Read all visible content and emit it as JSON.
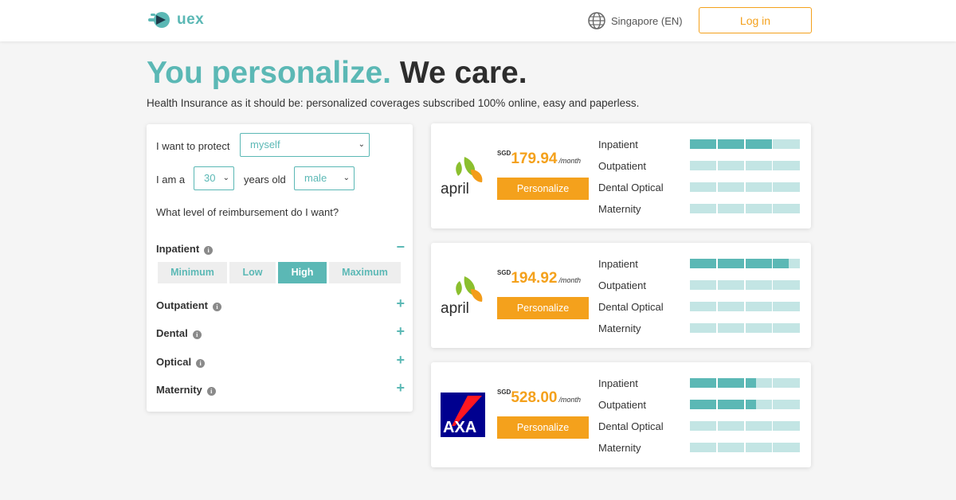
{
  "header": {
    "brand": "uex",
    "region": "Singapore (EN)",
    "login_label": "Log in"
  },
  "hero": {
    "title_part1": "You personalize.",
    "title_part2": "We care.",
    "subtitle": "Health Insurance as it should be: personalized coverages subscribed 100% online, easy and paperless."
  },
  "filters": {
    "protect_label": "I want to protect",
    "protect_value": "myself",
    "age_prefix": "I am a",
    "age_value": "30",
    "age_suffix": "years old",
    "gender_value": "male",
    "question": "What level of reimbursement do I want?",
    "levels": [
      "Minimum",
      "Low",
      "High",
      "Maximum"
    ],
    "selected_level": "High",
    "coverages": [
      {
        "label": "Inpatient",
        "expanded": true,
        "toggle": "−"
      },
      {
        "label": "Outpatient",
        "expanded": false,
        "toggle": "+"
      },
      {
        "label": "Dental",
        "expanded": false,
        "toggle": "+"
      },
      {
        "label": "Optical",
        "expanded": false,
        "toggle": "+"
      },
      {
        "label": "Maternity",
        "expanded": false,
        "toggle": "+"
      }
    ]
  },
  "plans": [
    {
      "insurer": "april",
      "currency": "SGD",
      "price": "179.94",
      "period": "/month",
      "button_label": "Personalize",
      "coverage": [
        {
          "name": "Inpatient",
          "level": 0.75
        },
        {
          "name": "Outpatient",
          "level": 0
        },
        {
          "name": "Dental Optical",
          "level": 0
        },
        {
          "name": "Maternity",
          "level": 0
        }
      ]
    },
    {
      "insurer": "april",
      "currency": "SGD",
      "price": "194.92",
      "period": "/month",
      "button_label": "Personalize",
      "coverage": [
        {
          "name": "Inpatient",
          "level": 0.9
        },
        {
          "name": "Outpatient",
          "level": 0
        },
        {
          "name": "Dental Optical",
          "level": 0
        },
        {
          "name": "Maternity",
          "level": 0
        }
      ]
    },
    {
      "insurer": "AXA",
      "currency": "SGD",
      "price": "528.00",
      "period": "/month",
      "button_label": "Personalize",
      "coverage": [
        {
          "name": "Inpatient",
          "level": 0.6
        },
        {
          "name": "Outpatient",
          "level": 0.6
        },
        {
          "name": "Dental Optical",
          "level": 0
        },
        {
          "name": "Maternity",
          "level": 0
        }
      ]
    }
  ],
  "colors": {
    "teal": "#5bb8b5",
    "teal_light": "#c3e5e4",
    "orange": "#f4a11c",
    "axa_blue": "#00008f",
    "axa_red": "#ff1721",
    "april_green": "#8bbf2e",
    "april_orange": "#f39c19"
  }
}
